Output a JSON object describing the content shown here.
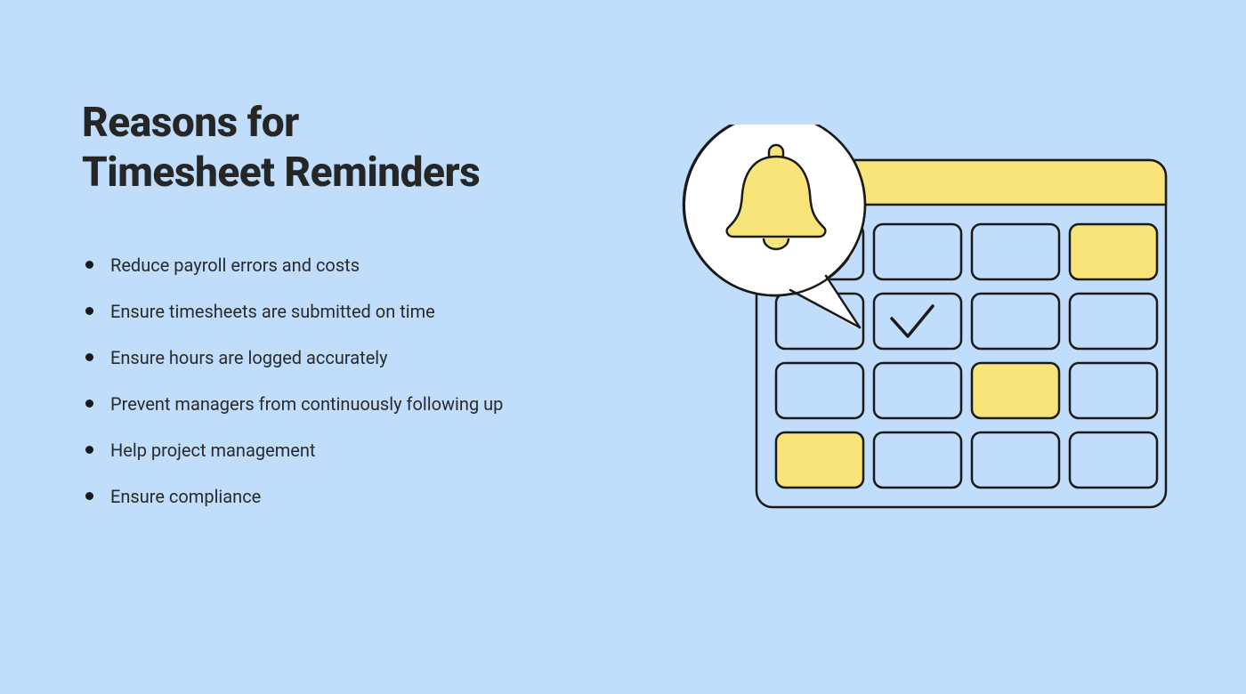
{
  "title": "Reasons for\nTimesheet Reminders",
  "bullets": [
    "Reduce payroll errors and costs",
    "Ensure timesheets are submitted on time",
    "Ensure hours are logged accurately",
    "Prevent managers from continuously following up",
    "Help project management",
    "Ensure compliance"
  ],
  "colors": {
    "background": "#C0DDFB",
    "accent_yellow": "#F9E47A",
    "stroke": "#1A1A1A",
    "text": "#262626"
  },
  "illustration": {
    "type": "calendar-with-bell",
    "calendar": {
      "header_color": "#F9E47A",
      "cells_rows": 4,
      "cells_cols": 4,
      "highlighted_cells": [
        [
          0,
          3
        ],
        [
          2,
          2
        ],
        [
          3,
          0
        ]
      ],
      "checked_cell": [
        1,
        1
      ]
    },
    "bell_icon": "bell"
  }
}
